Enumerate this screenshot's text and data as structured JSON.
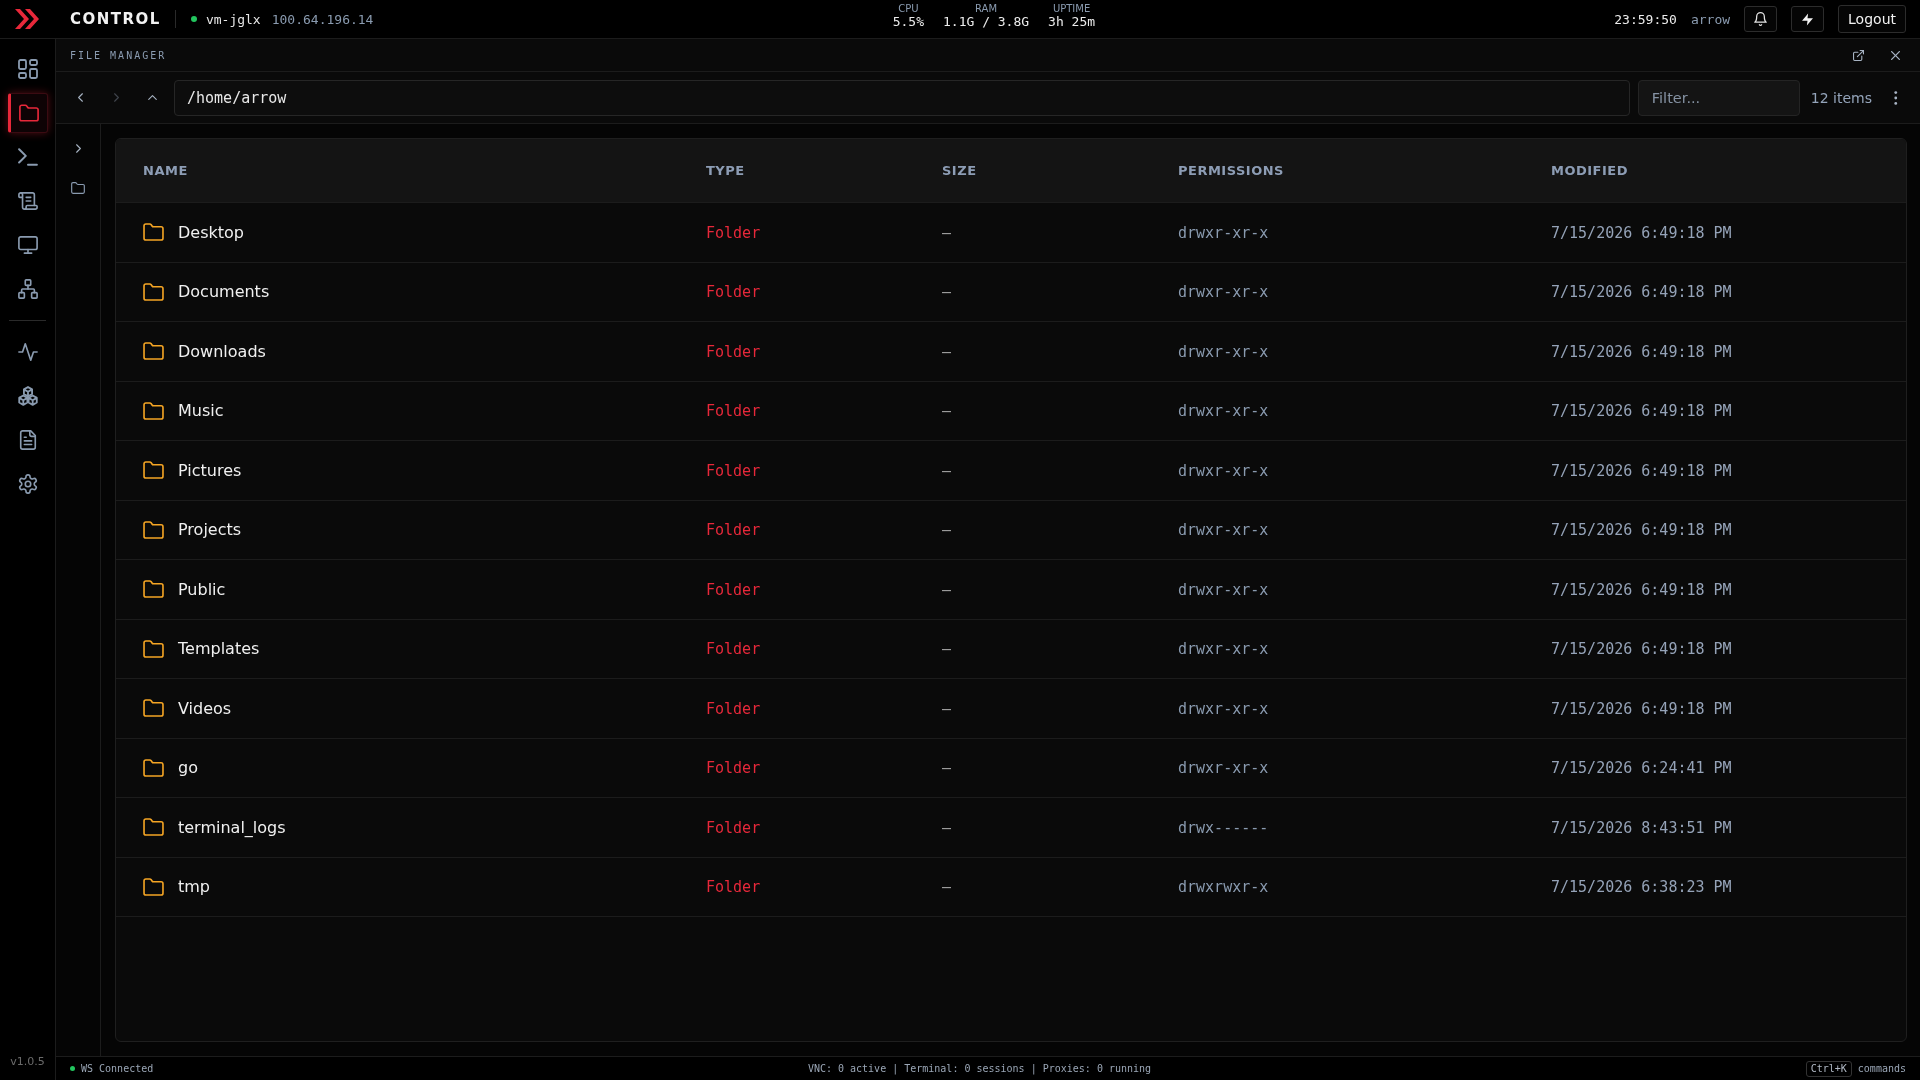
{
  "top_bar": {
    "brand": "CONTROL",
    "host": {
      "name": "vm-jglx",
      "ip": "100.64.196.14",
      "online": true
    },
    "stats": [
      {
        "label": "CPU",
        "value": "5.5%"
      },
      {
        "label": "RAM",
        "value": "1.1G / 3.8G"
      },
      {
        "label": "UPTIME",
        "value": "3h 25m"
      }
    ],
    "time": "23:59:50",
    "user": "arrow",
    "logout": "Logout"
  },
  "sidebar": {
    "groups": [
      {
        "items": [
          {
            "kind": "grid",
            "selected": false
          },
          {
            "kind": "folder",
            "selected": true
          },
          {
            "kind": "terminal",
            "selected": false
          },
          {
            "kind": "scroll",
            "selected": false
          },
          {
            "kind": "monitor",
            "selected": false
          },
          {
            "kind": "network",
            "selected": false
          }
        ]
      },
      {
        "items": [
          {
            "kind": "pulse",
            "selected": false
          },
          {
            "kind": "cubes",
            "selected": false
          },
          {
            "kind": "document",
            "selected": false
          },
          {
            "kind": "gear",
            "selected": false
          }
        ]
      }
    ],
    "version": "v1.0.5"
  },
  "panel": {
    "title": "FILE MANAGER"
  },
  "path_bar": {
    "nav": [
      {
        "kind": "back",
        "disabled": false
      },
      {
        "kind": "forward",
        "disabled": true
      },
      {
        "kind": "up",
        "disabled": false
      }
    ],
    "path": "/home/arrow",
    "filter": {
      "placeholder": "Filter..."
    },
    "count": "12 items"
  },
  "tree": {
    "expanded": false
  },
  "table": {
    "columns": [
      "NAME",
      "TYPE",
      "SIZE",
      "PERMISSIONS",
      "MODIFIED"
    ],
    "rows": [
      {
        "kind": "folder",
        "name": "Desktop",
        "type": "Folder",
        "size": "—",
        "permissions": "drwxr-xr-x",
        "modified": "7/15/2026 6:49:18 PM"
      },
      {
        "kind": "folder",
        "name": "Documents",
        "type": "Folder",
        "size": "—",
        "permissions": "drwxr-xr-x",
        "modified": "7/15/2026 6:49:18 PM"
      },
      {
        "kind": "folder",
        "name": "Downloads",
        "type": "Folder",
        "size": "—",
        "permissions": "drwxr-xr-x",
        "modified": "7/15/2026 6:49:18 PM"
      },
      {
        "kind": "folder",
        "name": "Music",
        "type": "Folder",
        "size": "—",
        "permissions": "drwxr-xr-x",
        "modified": "7/15/2026 6:49:18 PM"
      },
      {
        "kind": "folder",
        "name": "Pictures",
        "type": "Folder",
        "size": "—",
        "permissions": "drwxr-xr-x",
        "modified": "7/15/2026 6:49:18 PM"
      },
      {
        "kind": "folder",
        "name": "Projects",
        "type": "Folder",
        "size": "—",
        "permissions": "drwxr-xr-x",
        "modified": "7/15/2026 6:49:18 PM"
      },
      {
        "kind": "folder",
        "name": "Public",
        "type": "Folder",
        "size": "—",
        "permissions": "drwxr-xr-x",
        "modified": "7/15/2026 6:49:18 PM"
      },
      {
        "kind": "folder",
        "name": "Templates",
        "type": "Folder",
        "size": "—",
        "permissions": "drwxr-xr-x",
        "modified": "7/15/2026 6:49:18 PM"
      },
      {
        "kind": "folder",
        "name": "Videos",
        "type": "Folder",
        "size": "—",
        "permissions": "drwxr-xr-x",
        "modified": "7/15/2026 6:49:18 PM"
      },
      {
        "kind": "folder",
        "name": "go",
        "type": "Folder",
        "size": "—",
        "permissions": "drwxr-xr-x",
        "modified": "7/15/2026 6:24:41 PM"
      },
      {
        "kind": "folder",
        "name": "terminal_logs",
        "type": "Folder",
        "size": "—",
        "permissions": "drwx------",
        "modified": "7/15/2026 8:43:51 PM"
      },
      {
        "kind": "folder",
        "name": "tmp",
        "type": "Folder",
        "size": "—",
        "permissions": "drwxrwxr-x",
        "modified": "7/15/2026 6:38:23 PM"
      }
    ]
  },
  "status_bar": {
    "connection": {
      "label": "WS Connected",
      "connected": true
    },
    "summary": "VNC: 0 active | Terminal: 0 sessions | Proxies: 0 running",
    "shortcut": {
      "key": "Ctrl+K",
      "label": "commands"
    }
  }
}
